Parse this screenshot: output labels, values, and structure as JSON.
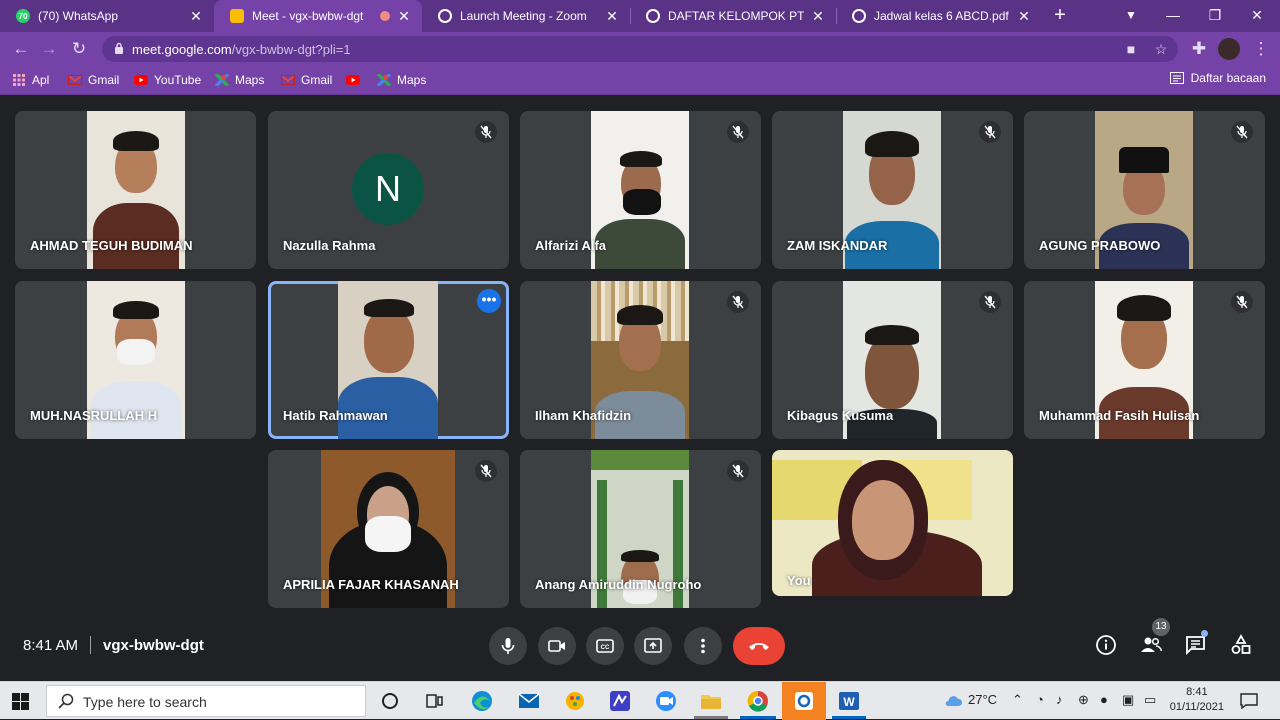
{
  "browser": {
    "tabs": [
      {
        "title": "(70) WhatsApp",
        "icon": "whatsapp-icon",
        "color": "#25d366",
        "badge": "70",
        "active": false
      },
      {
        "title": "Meet - vgx-bwbw-dgt",
        "icon": "meet-icon",
        "color": "#00897b",
        "active": true
      },
      {
        "title": "Launch Meeting - Zoom",
        "icon": "globe-icon",
        "color": "#ffffff",
        "active": false
      },
      {
        "title": "DAFTAR KELOMPOK PTM SISW",
        "icon": "globe-icon",
        "color": "#ffffff",
        "active": false
      },
      {
        "title": "Jadwal kelas 6 ABCD.pdf",
        "icon": "globe-icon",
        "color": "#ffffff",
        "active": false
      }
    ],
    "url_host": "meet.google.com",
    "url_path": "/vgx-bwbw-dgt?pli=1",
    "bookmarks": [
      {
        "label": "Apl",
        "icon": "apps-grid-icon"
      },
      {
        "label": "Gmail",
        "icon": "gmail-icon"
      },
      {
        "label": "YouTube",
        "icon": "youtube-icon"
      },
      {
        "label": "Maps",
        "icon": "maps-icon"
      },
      {
        "label": "Gmail",
        "icon": "gmail-icon"
      },
      {
        "label": "",
        "icon": "youtube-icon"
      },
      {
        "label": "Maps",
        "icon": "maps-icon"
      }
    ],
    "reading_list": "Daftar bacaan"
  },
  "meet": {
    "participants": [
      {
        "name": "AHMAD TEGUH BUDIMAN",
        "muted": false,
        "video": true
      },
      {
        "name": "Nazulla Rahma",
        "muted": true,
        "video": false,
        "initial": "N"
      },
      {
        "name": "Alfarizi Alfa",
        "muted": true,
        "video": true
      },
      {
        "name": "ZAM ISKANDAR",
        "muted": true,
        "video": true
      },
      {
        "name": "AGUNG PRABOWO",
        "muted": true,
        "video": true
      },
      {
        "name": "MUH.NASRULLAH H",
        "muted": false,
        "video": true
      },
      {
        "name": "Hatib Rahmawan",
        "muted": false,
        "video": true,
        "speaking": true
      },
      {
        "name": "Ilham Khafidzin",
        "muted": true,
        "video": true
      },
      {
        "name": "Kibagus Kusuma",
        "muted": true,
        "video": true
      },
      {
        "name": "Muhammad Fasih Hulisan",
        "muted": true,
        "video": true
      },
      {
        "name": "APRILIA FAJAR KHASANAH",
        "muted": true,
        "video": true
      },
      {
        "name": "Anang Amiruddin Nugroho",
        "muted": true,
        "video": true
      },
      {
        "name": "You",
        "muted": false,
        "video": true
      }
    ],
    "time": "8:41 AM",
    "meeting_code": "vgx-bwbw-dgt",
    "participant_count": "13"
  },
  "taskbar": {
    "search_placeholder": "Type here to search",
    "weather": "27°C",
    "clock_time": "8:41",
    "clock_date": "01/11/2021"
  }
}
